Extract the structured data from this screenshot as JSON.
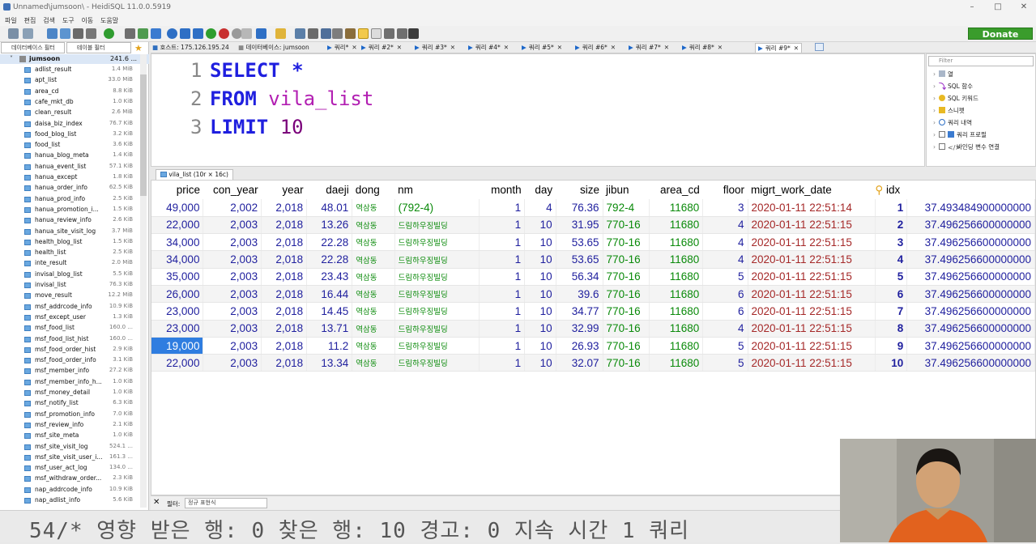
{
  "window": {
    "title": "Unnamed\\jumsoon\\ - HeidiSQL 11.0.0.5919"
  },
  "menu": [
    "파일",
    "편집",
    "검색",
    "도구",
    "이동",
    "도움말"
  ],
  "toolbar": {
    "donate_label": "Donate"
  },
  "left_panel": {
    "db_filter_placeholder": "데이터베이스 필터",
    "table_filter_placeholder": "테이블 필터",
    "database": {
      "name": "jumsoon",
      "size": "241.6 ..."
    },
    "tables": [
      {
        "name": "adlist_result",
        "size": "1.4 MiB"
      },
      {
        "name": "apt_list",
        "size": "33.0 MiB"
      },
      {
        "name": "area_cd",
        "size": "8.8 KiB"
      },
      {
        "name": "cafe_mkt_db",
        "size": "1.0 KiB"
      },
      {
        "name": "clean_result",
        "size": "2.6 MiB"
      },
      {
        "name": "daisa_biz_index",
        "size": "76.7 KiB"
      },
      {
        "name": "food_blog_list",
        "size": "3.2 KiB"
      },
      {
        "name": "food_list",
        "size": "3.6 KiB"
      },
      {
        "name": "hanua_blog_meta",
        "size": "1.4 KiB"
      },
      {
        "name": "hanua_event_list",
        "size": "57.1 KiB"
      },
      {
        "name": "hanua_except",
        "size": "1.8 KiB"
      },
      {
        "name": "hanua_order_info",
        "size": "62.5 KiB"
      },
      {
        "name": "hanua_prod_info",
        "size": "2.5 KiB"
      },
      {
        "name": "hanua_promotion_i...",
        "size": "1.5 KiB"
      },
      {
        "name": "hanua_review_info",
        "size": "2.6 KiB"
      },
      {
        "name": "hanua_site_visit_log",
        "size": "3.7 MiB"
      },
      {
        "name": "health_blog_list",
        "size": "1.5 KiB"
      },
      {
        "name": "health_list",
        "size": "2.5 KiB"
      },
      {
        "name": "inte_result",
        "size": "2.0 MiB"
      },
      {
        "name": "invisal_blog_list",
        "size": "5.5 KiB"
      },
      {
        "name": "invisal_list",
        "size": "76.3 KiB"
      },
      {
        "name": "move_result",
        "size": "12.2 MiB"
      },
      {
        "name": "msf_addrcode_info",
        "size": "10.9 KiB"
      },
      {
        "name": "msf_except_user",
        "size": "1.3 KiB"
      },
      {
        "name": "msf_food_list",
        "size": "160.0 ..."
      },
      {
        "name": "msf_food_list_hist",
        "size": "160.0 ..."
      },
      {
        "name": "msf_food_order_hist",
        "size": "2.9 KiB"
      },
      {
        "name": "msf_food_order_info",
        "size": "3.1 KiB"
      },
      {
        "name": "msf_member_info",
        "size": "27.2 KiB"
      },
      {
        "name": "msf_member_info_h...",
        "size": "1.0 KiB"
      },
      {
        "name": "msf_money_detail",
        "size": "1.0 KiB"
      },
      {
        "name": "msf_notify_list",
        "size": "6.3 KiB"
      },
      {
        "name": "msf_promotion_info",
        "size": "7.0 KiB"
      },
      {
        "name": "msf_review_info",
        "size": "2.1 KiB"
      },
      {
        "name": "msf_site_meta",
        "size": "1.0 KiB"
      },
      {
        "name": "msf_site_visit_log",
        "size": "524.1 ..."
      },
      {
        "name": "msf_site_visit_user_i...",
        "size": "161.3 ..."
      },
      {
        "name": "msf_user_act_log",
        "size": "134.0 ..."
      },
      {
        "name": "msf_withdraw_order...",
        "size": "2.3 KiB"
      },
      {
        "name": "nap_addrcode_info",
        "size": "10.9 KiB"
      },
      {
        "name": "nap_adlist_info",
        "size": "5.6 KiB"
      }
    ]
  },
  "tabs": [
    {
      "label": "호스트: 175.126.195.24"
    },
    {
      "label": "데이터베이스: jumsoon"
    },
    {
      "label": "쿼리*"
    },
    {
      "label": "쿼리 #2*"
    },
    {
      "label": "쿼리 #3*"
    },
    {
      "label": "쿼리 #4*"
    },
    {
      "label": "쿼리 #5*"
    },
    {
      "label": "쿼리 #6*"
    },
    {
      "label": "쿼리 #7*"
    },
    {
      "label": "쿼리 #8*"
    },
    {
      "label": "쿼리 #9*"
    }
  ],
  "editor": {
    "lines": [
      {
        "num": "1",
        "kw": "SELECT",
        "rest": " *"
      },
      {
        "num": "2",
        "kw": "FROM",
        "rest": " vila_list"
      },
      {
        "num": "3",
        "kw": "LIMIT",
        "rest": " 10"
      }
    ]
  },
  "helper": {
    "filter_placeholder": "Filter",
    "items": [
      "열",
      "SQL 함수",
      "SQL 키워드",
      "스니펫",
      "쿼리 내역",
      "쿼리 프로필",
      "바인딩 변수 연결"
    ]
  },
  "result": {
    "tab_label": "vila_list (10r × 16c)",
    "columns": [
      "price",
      "con_year",
      "year",
      "daeji",
      "dong",
      "nm",
      "month",
      "day",
      "size",
      "jibun",
      "area_cd",
      "floor",
      "migrt_work_date",
      "idx",
      ""
    ],
    "rows": [
      [
        "49,000",
        "2,002",
        "2,018",
        "48.01",
        "역삼동",
        "(792-4)",
        "1",
        "4",
        "76.36",
        "792-4",
        "11680",
        "3",
        "2020-01-11 22:51:14",
        "1",
        "37.493484900000000"
      ],
      [
        "22,000",
        "2,003",
        "2,018",
        "13.26",
        "역삼동",
        "드림하우징빌딩",
        "1",
        "10",
        "31.95",
        "770-16",
        "11680",
        "4",
        "2020-01-11 22:51:15",
        "2",
        "37.496256600000000"
      ],
      [
        "34,000",
        "2,003",
        "2,018",
        "22.28",
        "역삼동",
        "드림하우징빌딩",
        "1",
        "10",
        "53.65",
        "770-16",
        "11680",
        "4",
        "2020-01-11 22:51:15",
        "3",
        "37.496256600000000"
      ],
      [
        "34,000",
        "2,003",
        "2,018",
        "22.28",
        "역삼동",
        "드림하우징빌딩",
        "1",
        "10",
        "53.65",
        "770-16",
        "11680",
        "4",
        "2020-01-11 22:51:15",
        "4",
        "37.496256600000000"
      ],
      [
        "35,000",
        "2,003",
        "2,018",
        "23.43",
        "역삼동",
        "드림하우징빌딩",
        "1",
        "10",
        "56.34",
        "770-16",
        "11680",
        "5",
        "2020-01-11 22:51:15",
        "5",
        "37.496256600000000"
      ],
      [
        "26,000",
        "2,003",
        "2,018",
        "16.44",
        "역삼동",
        "드림하우징빌딩",
        "1",
        "10",
        "39.6",
        "770-16",
        "11680",
        "6",
        "2020-01-11 22:51:15",
        "6",
        "37.496256600000000"
      ],
      [
        "23,000",
        "2,003",
        "2,018",
        "14.45",
        "역삼동",
        "드림하우징빌딩",
        "1",
        "10",
        "34.77",
        "770-16",
        "11680",
        "6",
        "2020-01-11 22:51:15",
        "7",
        "37.496256600000000"
      ],
      [
        "23,000",
        "2,003",
        "2,018",
        "13.71",
        "역삼동",
        "드림하우징빌딩",
        "1",
        "10",
        "32.99",
        "770-16",
        "11680",
        "4",
        "2020-01-11 22:51:15",
        "8",
        "37.496256600000000"
      ],
      [
        "19,000",
        "2,003",
        "2,018",
        "11.2",
        "역삼동",
        "드림하우징빌딩",
        "1",
        "10",
        "26.93",
        "770-16",
        "11680",
        "5",
        "2020-01-11 22:51:15",
        "9",
        "37.496256600000000"
      ],
      [
        "22,000",
        "2,003",
        "2,018",
        "13.34",
        "역삼동",
        "드림하우징빌딩",
        "1",
        "10",
        "32.07",
        "770-16",
        "11680",
        "5",
        "2020-01-11 22:51:15",
        "10",
        "37.496256600000000"
      ]
    ]
  },
  "filterbar": {
    "label": "필터:",
    "placeholder": "정규 표현식"
  },
  "status": {
    "text": "54/* 영향 받은 행: 0  찾은 행: 10  경고: 0  지속 시간 1 쿼리"
  }
}
